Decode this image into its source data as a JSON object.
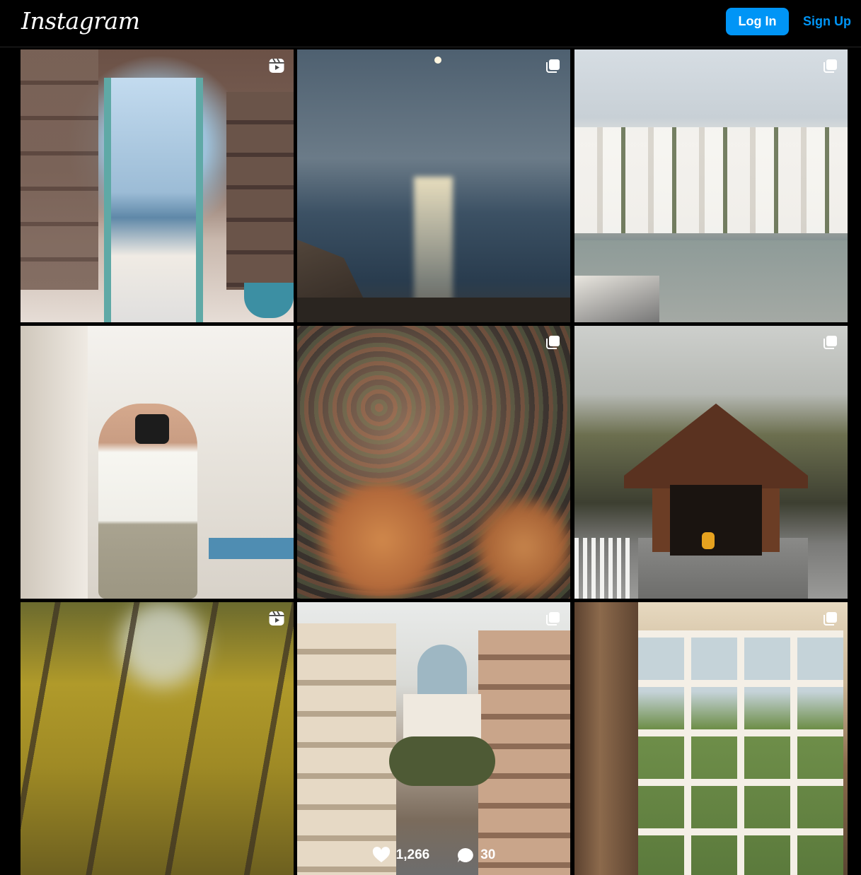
{
  "header": {
    "logo_text": "Instagram",
    "login_label": "Log In",
    "signup_label": "Sign Up"
  },
  "colors": {
    "background": "#000000",
    "accent": "#0095f6"
  },
  "grid": {
    "tiles": [
      {
        "badge": "reel-icon",
        "subject": "pottery studio doorway"
      },
      {
        "badge": "carousel-icon",
        "subject": "moonlight over sea"
      },
      {
        "badge": "carousel-icon",
        "subject": "whitewashed harbor town"
      },
      {
        "badge": "",
        "subject": "woman with camera"
      },
      {
        "badge": "carousel-icon",
        "subject": "autumn forest path"
      },
      {
        "badge": "carousel-icon",
        "subject": "covered bridge"
      },
      {
        "badge": "reel-icon",
        "subject": "yellow autumn trees"
      },
      {
        "badge": "carousel-icon",
        "subject": "street with domed church",
        "likes": "1,266",
        "comments": "30"
      },
      {
        "badge": "carousel-icon",
        "subject": "window with curtains"
      }
    ]
  }
}
